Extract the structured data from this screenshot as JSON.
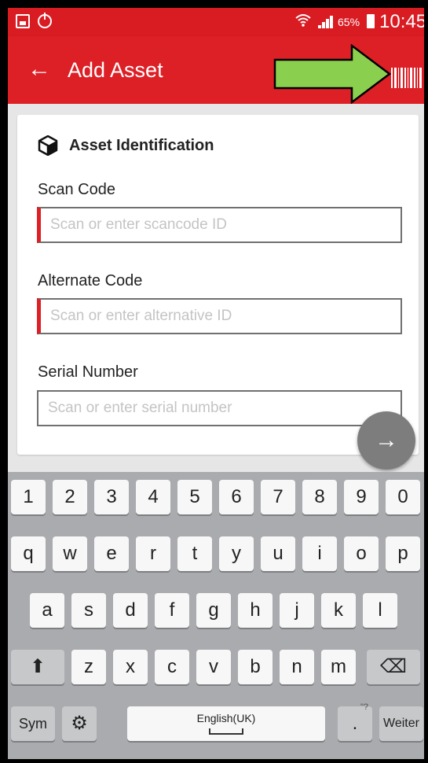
{
  "status_bar": {
    "battery_text": "65%",
    "time": "10:45",
    "icons": [
      "image-notification-icon",
      "power-icon",
      "wifi-icon",
      "signal-icon",
      "battery-icon"
    ]
  },
  "app_bar": {
    "back_icon": "←",
    "title": "Add Asset",
    "scan_icon": "barcode-icon",
    "annotation_color": "#8bcf4f"
  },
  "card": {
    "title": "Asset Identification",
    "icon": "cube-icon",
    "fields": [
      {
        "label": "Scan Code",
        "placeholder": "Scan or enter scancode ID",
        "value": ""
      },
      {
        "label": "Alternate Code",
        "placeholder": "Scan or enter alternative ID",
        "value": ""
      },
      {
        "label": "Serial Number",
        "placeholder": "Scan or enter serial number",
        "value": ""
      }
    ],
    "next_icon": "→"
  },
  "keyboard": {
    "row_numbers": [
      "1",
      "2",
      "3",
      "4",
      "5",
      "6",
      "7",
      "8",
      "9",
      "0"
    ],
    "row_1": [
      "q",
      "w",
      "e",
      "r",
      "t",
      "y",
      "u",
      "i",
      "o",
      "p"
    ],
    "row_2": [
      "a",
      "s",
      "d",
      "f",
      "g",
      "h",
      "j",
      "k",
      "l"
    ],
    "row_3": [
      "z",
      "x",
      "c",
      "v",
      "b",
      "n",
      "m"
    ],
    "shift": "⬆",
    "backspace": "⌫",
    "sym": "Sym",
    "settings": "⚙",
    "space": "English(UK)",
    "period": ".",
    "period_sub": "\"?",
    "enter": "Weiter"
  },
  "colors": {
    "primary": "#dd1f26",
    "keyboard_bg": "#a9abae",
    "fab": "#7d7d7d"
  }
}
